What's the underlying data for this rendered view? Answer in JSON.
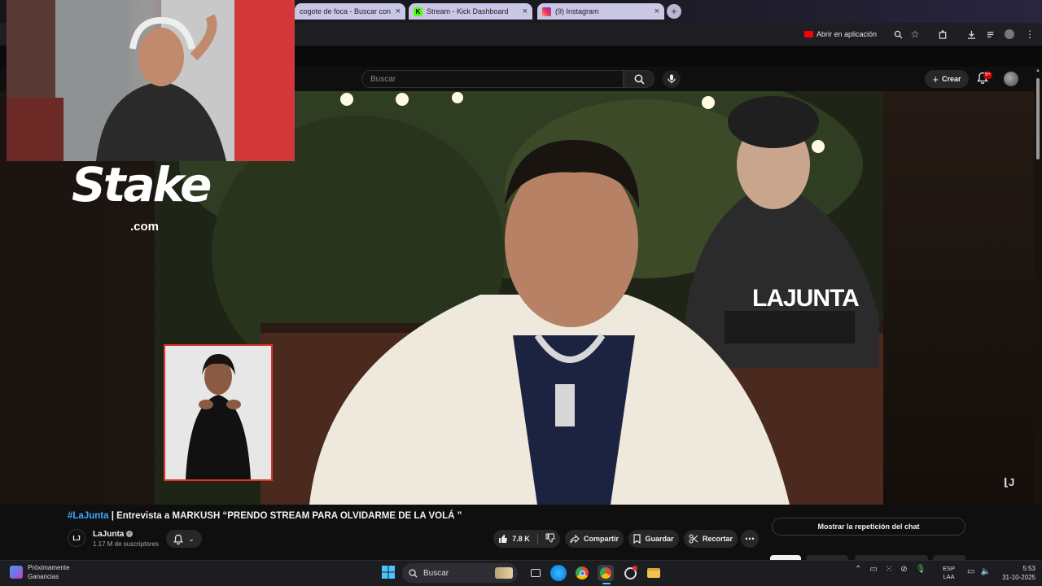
{
  "browser": {
    "tabs": [
      {
        "label": "cogote de foca - Buscar con G",
        "favicon": "bing-icon"
      },
      {
        "label": "Stream - Kick Dashboard",
        "favicon": "kick-icon"
      },
      {
        "label": "(9) Instagram",
        "favicon": "instagram-icon"
      }
    ],
    "open_in_app": "Abrir en aplicación"
  },
  "youtube": {
    "search_placeholder": "Buscar",
    "create_label": "Crear",
    "notif_count": "9+",
    "video": {
      "hashtag": "#LaJunta",
      "title": " | Entrevista a MARKUSH “PRENDO STREAM PARA OLVIDARME DE LA VOLÁ ”",
      "watermark": "LAJUNTA",
      "overlay_sponsor": "Stake",
      "overlay_sponsor_sub": ".com"
    },
    "channel": {
      "name": "LaJunta",
      "subscribers": "1.17 M de suscriptores",
      "avatar_letter": "LJ"
    },
    "actions": {
      "likes": "7.8 K",
      "share": "Compartir",
      "save": "Guardar",
      "clip": "Recortar"
    },
    "chat_replay": "Mostrar la repetición del chat"
  },
  "taskbar": {
    "weather_line1": "Próximamente",
    "weather_line2": "Ganancias",
    "search_label": "Buscar",
    "lang_line1": "ESP",
    "lang_line2": "LAA",
    "time": "5:53",
    "date": "31-10-2025"
  },
  "colors": {
    "accent_link": "#3ea6ff",
    "youtube_red": "#ff0000",
    "sign_border": "#e0332d"
  }
}
